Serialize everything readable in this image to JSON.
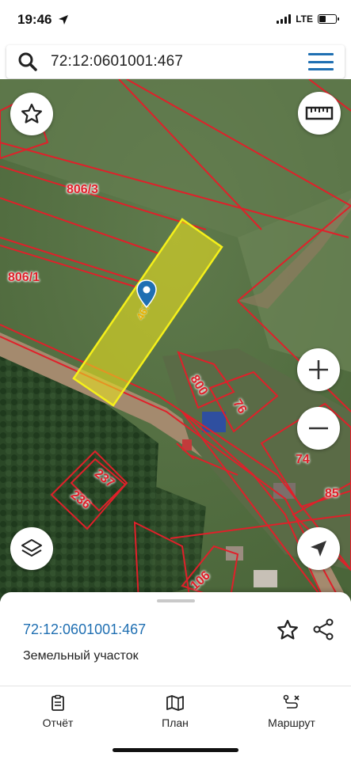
{
  "status_bar": {
    "time": "19:46",
    "network": "LTE",
    "icons": [
      "location-arrow-icon",
      "signal-icon",
      "battery-icon"
    ]
  },
  "search": {
    "value": "72:12:0601001:467",
    "icons": [
      "search-icon",
      "menu-icon"
    ]
  },
  "map": {
    "parcel_labels": [
      "806/3",
      "806/1",
      "467",
      "800",
      "76",
      "74",
      "85",
      "237",
      "236",
      "106"
    ],
    "colors": {
      "boundary": "#e0202a",
      "selected_fill": "#e8e020",
      "selected_stroke": "#f5f01a",
      "marker": "#1f6fb2"
    },
    "controls": [
      "favorite-star-icon",
      "ruler-icon",
      "zoom-in-icon",
      "zoom-out-icon",
      "layers-icon",
      "locate-arrow-icon"
    ]
  },
  "card": {
    "title": "72:12:0601001:467",
    "subtitle": "Земельный участок",
    "icons": [
      "star-icon",
      "share-icon"
    ]
  },
  "tabs": [
    {
      "label": "Отчёт",
      "icon": "report-icon"
    },
    {
      "label": "План",
      "icon": "map-plan-icon"
    },
    {
      "label": "Маршрут",
      "icon": "route-icon"
    }
  ]
}
